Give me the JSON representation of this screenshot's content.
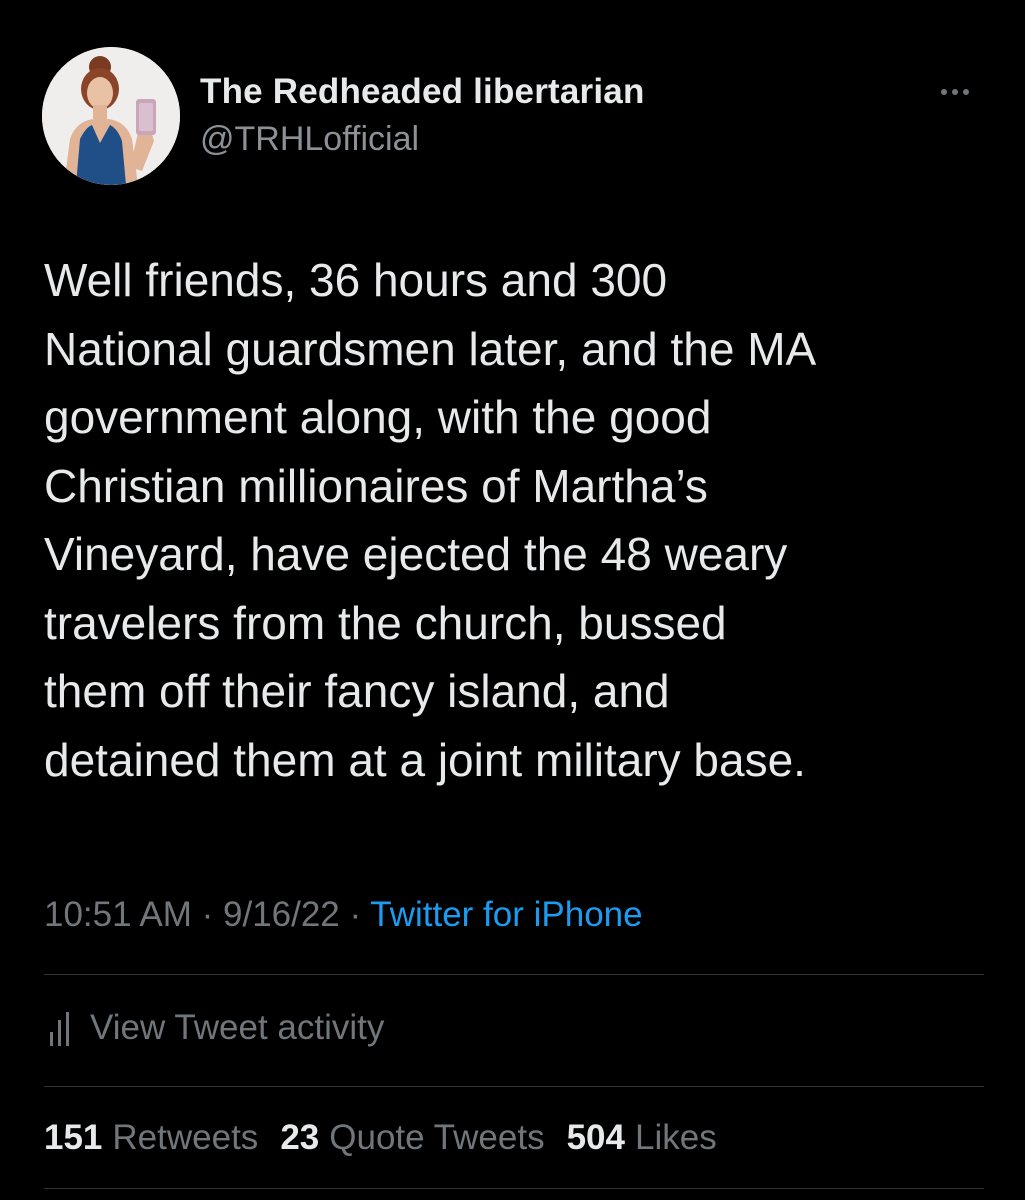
{
  "author": {
    "display_name": "The Redheaded libertarian",
    "handle": "@TRHLofficial"
  },
  "tweet": {
    "text": "Well friends, 36 hours and 300\nNational guardsmen later, and the MA\ngovernment along, with the good\nChristian millionaires of Martha’s\nVineyard, have ejected the 48 weary\ntravelers from the church, bussed\nthem off their fancy island, and\ndetained them at a joint military base."
  },
  "meta": {
    "time": "10:51 AM",
    "separator": " · ",
    "date": "9/16/22",
    "source": "Twitter for iPhone"
  },
  "activity": {
    "label": "View Tweet activity"
  },
  "stats": {
    "retweets_count": "151",
    "retweets_label": "Retweets",
    "quotes_count": "23",
    "quotes_label": "Quote Tweets",
    "likes_count": "504",
    "likes_label": "Likes"
  },
  "icons": {
    "more": "more-horizontal-icon",
    "activity": "bar-chart-icon"
  },
  "colors": {
    "background": "#000000",
    "text_primary": "#e7e9ea",
    "text_secondary": "#71767b",
    "accent": "#1d9bf0",
    "divider": "#2f3336"
  }
}
